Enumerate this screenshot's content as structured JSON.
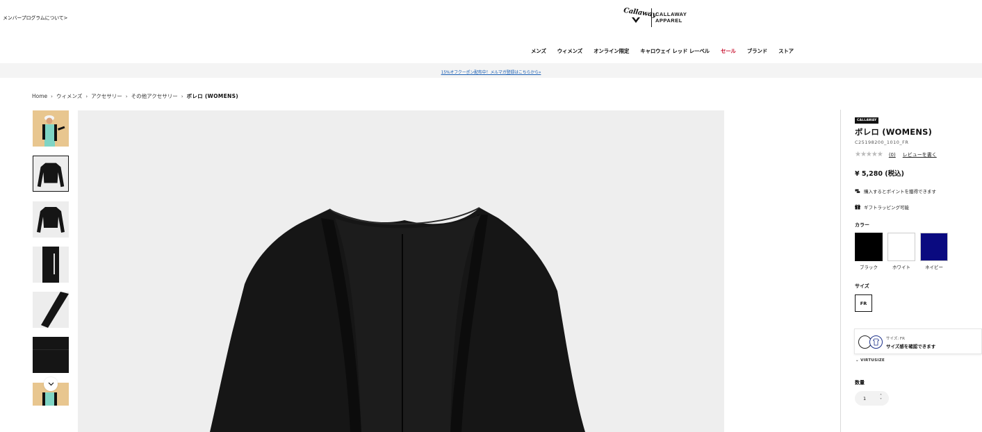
{
  "header": {
    "member_link": "メンバープログラムについて>",
    "logo_script": "Callaway",
    "logo_line1": "CALLAWAY",
    "logo_line2": "APPAREL"
  },
  "nav": {
    "items": [
      {
        "label": "メンズ"
      },
      {
        "label": "ウィメンズ"
      },
      {
        "label": "オンライン限定"
      },
      {
        "label": "キャロウェイ レッド レーベル"
      },
      {
        "label": "セール"
      },
      {
        "label": "ブランド"
      },
      {
        "label": "ストア"
      }
    ],
    "sale_color": "#c8102e"
  },
  "promo": {
    "text": "15%オフクーポン配布中！メルマガ登録はこちらから»"
  },
  "breadcrumb": {
    "items": [
      "Home",
      "ウィメンズ",
      "アクセサリー",
      "その他アクセサリー"
    ],
    "current": "ボレロ (WOMENS)"
  },
  "gallery": {
    "thumbnails": [
      {
        "desc": "model-photo"
      },
      {
        "desc": "bolero-front"
      },
      {
        "desc": "bolero-front-2"
      },
      {
        "desc": "logo-detail"
      },
      {
        "desc": "sleeve-detail"
      },
      {
        "desc": "fabric-detail"
      },
      {
        "desc": "model-photo-2"
      }
    ],
    "selected_index": 1
  },
  "product": {
    "brand": "CALLAWAY",
    "name": "ボレロ (WOMENS)",
    "code": "C25198200_1010_FR",
    "stars": "★★★★★",
    "review_count": "(0)",
    "review_link": "レビューを書く",
    "price": "¥ 5,280 (税込)",
    "features": [
      {
        "icon": "points-icon",
        "label": "購入するとポイントを獲得できます"
      },
      {
        "icon": "gift-icon",
        "label": "ギフトラッピング可能"
      }
    ],
    "color_label": "カラー",
    "colors": [
      {
        "name": "ブラック",
        "hex": "#000000"
      },
      {
        "name": "ホワイト",
        "hex": "#ffffff"
      },
      {
        "name": "ネイビー",
        "hex": "#0a0a80"
      }
    ],
    "size_label": "サイズ",
    "sizes": [
      "FR"
    ],
    "qty_label": "数量",
    "qty_value": "1"
  },
  "virtusize": {
    "size_text": "サイズ: FR",
    "check_text": "サイズ感を確認できます",
    "brand": "VIRTUSIZE"
  }
}
